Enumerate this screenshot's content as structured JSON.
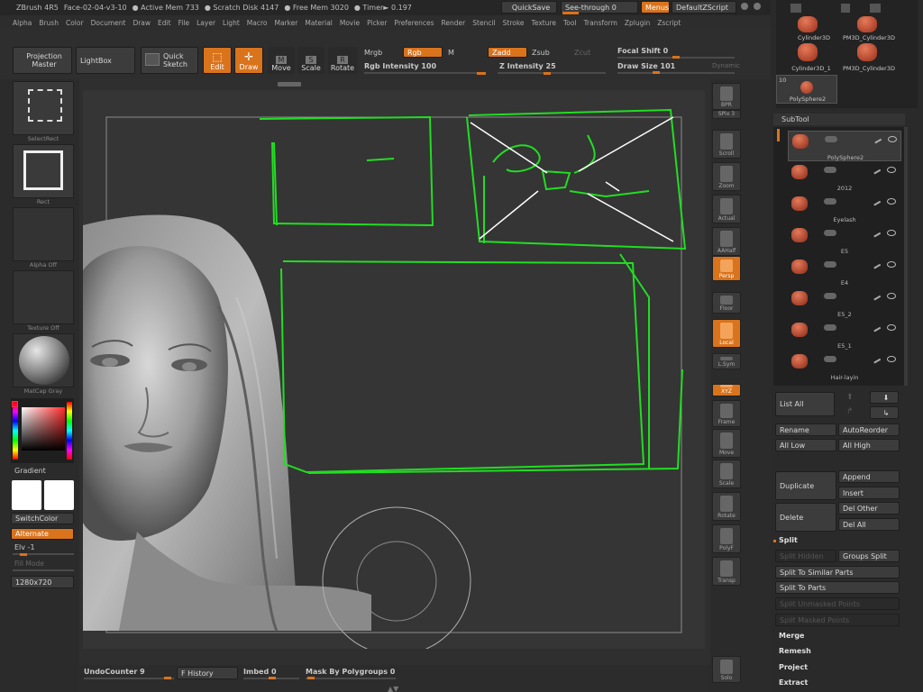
{
  "titlebar": {
    "app": "ZBrush 4R5",
    "file": "Face-02-04-v3-10",
    "active_mem": "● Active Mem 733",
    "scratch_disk": "● Scratch Disk 4147",
    "free_mem": "● Free Mem 3020",
    "timer": "● Timer► 0.197",
    "quicksave": "QuickSave",
    "see_through": "See-through  0",
    "menus": "Menus",
    "default_zscript": "DefaultZScript"
  },
  "menubar": [
    "Alpha",
    "Brush",
    "Color",
    "Document",
    "Draw",
    "Edit",
    "File",
    "Layer",
    "Light",
    "Macro",
    "Marker",
    "Material",
    "Movie",
    "Picker",
    "Preferences",
    "Render",
    "Stencil",
    "Stroke",
    "Texture",
    "Tool",
    "Transform",
    "Zplugin",
    "Zscript"
  ],
  "shelf": {
    "projection_master": "Projection Master",
    "lightbox": "LightBox",
    "quick_sketch": "Quick Sketch",
    "edit": "Edit",
    "draw": "Draw",
    "move": "Move",
    "scale": "Scale",
    "rotate": "Rotate",
    "mrgb": "Mrgb",
    "rgb": "Rgb",
    "m": "M",
    "zadd": "Zadd",
    "zsub": "Zsub",
    "zcut": "Zcut",
    "rgb_intensity": "Rgb  Intensity 100",
    "z_intensity": "Z  Intensity 25",
    "focal_shift": "Focal Shift 0",
    "draw_size": "Draw Size 101",
    "dynamic": "Dynamic"
  },
  "left": {
    "select_rect": "SelectRect",
    "rect": "Rect",
    "alpha_off": "Alpha Off",
    "texture_off": "Texture Off",
    "matcap": "MatCap Gray",
    "gradient": "Gradient",
    "switchcolor": "SwitchColor",
    "alternate": "Alternate",
    "elv": "Elv -1",
    "fill_mode": "Fill Mode",
    "size": "1280x720"
  },
  "rightstrip": [
    {
      "label": "BPR"
    },
    {
      "label": "SPix 3"
    },
    {
      "label": "Scroll"
    },
    {
      "label": "Zoom"
    },
    {
      "label": "Actual"
    },
    {
      "label": "AAHalf"
    },
    {
      "label": "Persp"
    },
    {
      "label": "Floor"
    },
    {
      "label": "Local"
    },
    {
      "label": "L.Sym"
    },
    {
      "label": "XYZ"
    },
    {
      "label": "Frame"
    },
    {
      "label": "Move"
    },
    {
      "label": "Scale"
    },
    {
      "label": "Rotate"
    },
    {
      "label": "PolyF"
    },
    {
      "label": "Transp"
    },
    {
      "label": "Solo"
    }
  ],
  "tools": {
    "cylinder3d": "Cylinder3D",
    "pm3d_cylinder3d": "PM3D_Cylinder3D",
    "cylinder3d_1": "Cylinder3D_1",
    "pm3d_cylinder3d_1": "PM3D_Cylinder3D",
    "polysphere_count": "10",
    "polysphere2": "PolySphere2"
  },
  "subtool": {
    "header": "SubTool",
    "items": [
      "PolySphere2",
      "2012",
      "Eyelash",
      "E5",
      "E4",
      "E5_2",
      "E5_1",
      "Hair-layin"
    ]
  },
  "subtool_actions": {
    "list_all": "List All",
    "rename": "Rename",
    "auto_reorder": "AutoReorder",
    "all_low": "All Low",
    "all_high": "All High",
    "duplicate": "Duplicate",
    "append": "Append",
    "insert": "Insert",
    "delete": "Delete",
    "del_other": "Del Other",
    "del_all": "Del All",
    "split": "Split",
    "split_hidden": "Split Hidden",
    "groups_split": "Groups Split",
    "split_to_similar": "Split To Similar Parts",
    "split_to_parts": "Split To Parts",
    "split_unmasked": "Split Unmasked Points",
    "split_masked": "Split Masked Points",
    "merge": "Merge",
    "remesh": "Remesh",
    "project": "Project",
    "extract": "Extract"
  },
  "bottom": {
    "undo_counter": "UndoCounter 9",
    "f_history": "F History",
    "imbed": "Imbed 0",
    "mask_by_polygroups": "Mask By Polygroups 0"
  },
  "colors": {
    "accent": "#d9731c",
    "sketch": "#22dd22"
  }
}
